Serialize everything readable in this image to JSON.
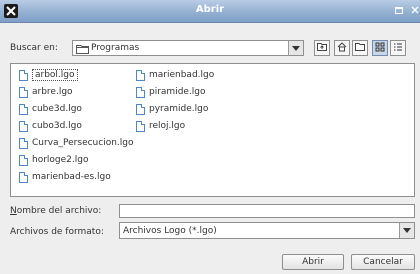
{
  "titlebar": {
    "title": "Abrir",
    "app_icon": "x-logo-icon",
    "restore_icon": "restore-window-icon",
    "close_icon": "close-icon"
  },
  "lookin": {
    "label": "Buscar en:",
    "value": "Programas",
    "folder_icon": "folder-icon",
    "toolbar_icons": [
      "up-folder-icon",
      "home-icon",
      "new-folder-icon",
      "list-view-icon",
      "details-view-icon"
    ]
  },
  "files": [
    {
      "name": "arbol.lgo",
      "selected": true
    },
    {
      "name": "arbre.lgo"
    },
    {
      "name": "cube3d.lgo"
    },
    {
      "name": "cubo3d.lgo"
    },
    {
      "name": "Curva_Persecucion.lgo"
    },
    {
      "name": "horloge2.lgo"
    },
    {
      "name": "marienbad-es.lgo"
    },
    {
      "name": "marienbad.lgo"
    },
    {
      "name": "piramide.lgo"
    },
    {
      "name": "pyramide.lgo"
    },
    {
      "name": "reloj.lgo"
    }
  ],
  "filename": {
    "label": "Nombre del archivo:",
    "value": ""
  },
  "filetype": {
    "label": "Archivos de formato:",
    "value": "Archivos Logo (*.lgo)"
  },
  "buttons": {
    "open": "Abrir",
    "cancel": "Cancelar"
  }
}
